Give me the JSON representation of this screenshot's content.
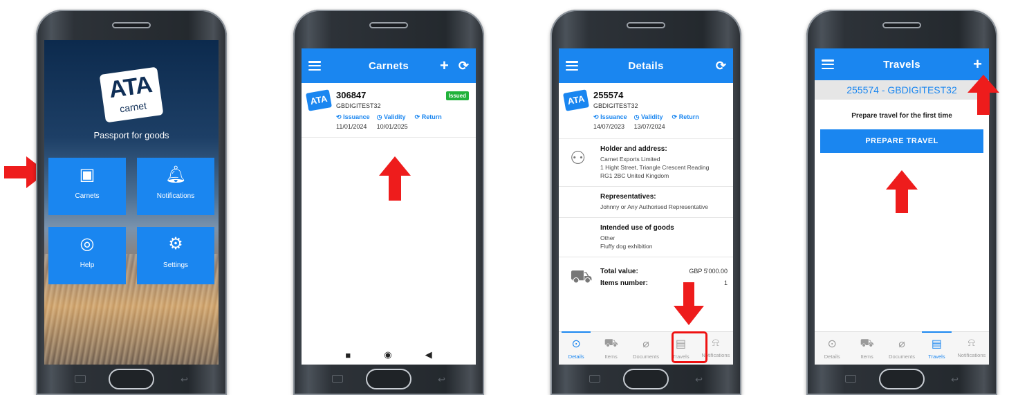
{
  "phone1": {
    "logo_main": "ATA",
    "logo_sub": "carnet",
    "tagline": "Passport for goods",
    "tiles": [
      {
        "label": "Carnets",
        "icon": "carnet-icon"
      },
      {
        "label": "Notifications",
        "icon": "bell-icon"
      },
      {
        "label": "Help",
        "icon": "lifebuoy-icon"
      },
      {
        "label": "Settings",
        "icon": "gear-icon"
      }
    ]
  },
  "phone2": {
    "title": "Carnets",
    "item": {
      "number": "306847",
      "ref": "GBDIGITEST32",
      "status": "Issued",
      "issuance_label": "Issuance",
      "issuance_date": "11/01/2024",
      "validity_label": "Validity",
      "validity_date": "10/01/2025",
      "return_label": "Return"
    }
  },
  "phone3": {
    "title": "Details",
    "item": {
      "number": "255574",
      "ref": "GBDIGITEST32",
      "issuance_label": "Issuance",
      "issuance_date": "14/07/2023",
      "validity_label": "Validity",
      "validity_date": "13/07/2024",
      "return_label": "Return"
    },
    "holder_title": "Holder and address:",
    "holder_lines": [
      "Carnet Exports Limited",
      "1 Hight Street, Triangle Crescent Reading",
      "RG1 2BC United Kingdom"
    ],
    "reps_title": "Representatives:",
    "reps_value": "Johnny or Any Authorised Representative",
    "use_title": "Intended use of goods",
    "use_lines": [
      "Other",
      "Fluffy dog exhibition"
    ],
    "total_label": "Total value:",
    "total_value": "GBP 5'000.00",
    "items_label": "Items number:",
    "items_value": "1",
    "tabs": [
      "Details",
      "Items",
      "Documents",
      "Travels",
      "Notifications"
    ]
  },
  "phone4": {
    "title": "Travels",
    "header": "255574 - GBDIGITEST32",
    "prompt": "Prepare travel for the first time",
    "button": "PREPARE TRAVEL",
    "tabs": [
      "Details",
      "Items",
      "Documents",
      "Travels",
      "Notifications"
    ]
  },
  "colors": {
    "accent": "#1a86f0",
    "issued": "#21b23a",
    "arrow": "#ee1c1c"
  }
}
